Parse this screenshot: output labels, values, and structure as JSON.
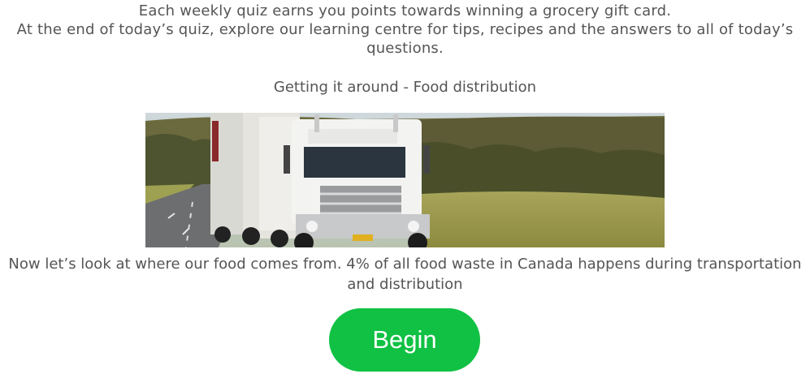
{
  "intro": {
    "line1": "Each weekly quiz earns you points towards winning a grocery gift card.",
    "line2": "At the end of today’s quiz, explore our learning centre for tips, recipes and the answers to all of today’s questions."
  },
  "section_title": "Getting it around - Food distribution",
  "image": {
    "subject": "road-train-truck-photo"
  },
  "caption": "Now let’s look at where our food comes from. 4% of all food waste in Canada happens during transportation and distribution",
  "begin_button": {
    "label": "Begin",
    "color": "#10c143"
  }
}
